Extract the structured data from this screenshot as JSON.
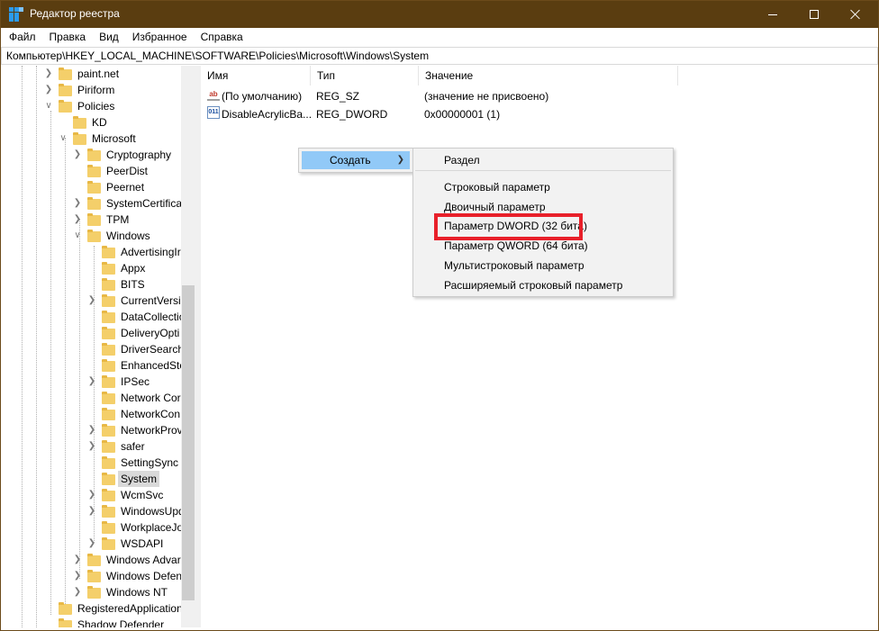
{
  "window": {
    "title": "Редактор реестра"
  },
  "menu": [
    "Файл",
    "Правка",
    "Вид",
    "Избранное",
    "Справка"
  ],
  "address": "Компьютер\\HKEY_LOCAL_MACHINE\\SOFTWARE\\Policies\\Microsoft\\Windows\\System",
  "tree": [
    {
      "label": "paint.net",
      "chev": ">"
    },
    {
      "label": "Piriform",
      "chev": ">"
    },
    {
      "label": "Policies",
      "chev": "v"
    },
    {
      "label": "KD",
      "chev": ""
    },
    {
      "label": "Microsoft",
      "chev": "v"
    },
    {
      "label": "Cryptography",
      "chev": ">"
    },
    {
      "label": "PeerDist",
      "chev": ""
    },
    {
      "label": "Peernet",
      "chev": ""
    },
    {
      "label": "SystemCertifica",
      "chev": ">"
    },
    {
      "label": "TPM",
      "chev": ">"
    },
    {
      "label": "Windows",
      "chev": "v"
    },
    {
      "label": "AdvertisingIr",
      "chev": ""
    },
    {
      "label": "Appx",
      "chev": ""
    },
    {
      "label": "BITS",
      "chev": ""
    },
    {
      "label": "CurrentVersio",
      "chev": ">"
    },
    {
      "label": "DataCollectio",
      "chev": ""
    },
    {
      "label": "DeliveryOpti",
      "chev": ""
    },
    {
      "label": "DriverSearch",
      "chev": ""
    },
    {
      "label": "EnhancedSto",
      "chev": ""
    },
    {
      "label": "IPSec",
      "chev": ">"
    },
    {
      "label": "Network Cor",
      "chev": ""
    },
    {
      "label": "NetworkCon",
      "chev": ""
    },
    {
      "label": "NetworkProv",
      "chev": ">"
    },
    {
      "label": "safer",
      "chev": ">"
    },
    {
      "label": "SettingSync",
      "chev": ""
    },
    {
      "label": "System",
      "chev": "",
      "selected": true
    },
    {
      "label": "WcmSvc",
      "chev": ">"
    },
    {
      "label": "WindowsUpd",
      "chev": ">"
    },
    {
      "label": "WorkplaceJo",
      "chev": ""
    },
    {
      "label": "WSDAPI",
      "chev": ">"
    },
    {
      "label": "Windows Advar",
      "chev": ">"
    },
    {
      "label": "Windows Defen",
      "chev": ">"
    },
    {
      "label": "Windows NT",
      "chev": ">"
    },
    {
      "label": "RegisteredApplication",
      "chev": ""
    },
    {
      "label": "Shadow Defender",
      "chev": ""
    }
  ],
  "columns": [
    "Имя",
    "Тип",
    "Значение"
  ],
  "values": [
    {
      "icon": "string-value-icon",
      "name": "(По умолчанию)",
      "type": "REG_SZ",
      "data": "(значение не присвоено)"
    },
    {
      "icon": "binary-value-icon",
      "name": "DisableAcrylicBa...",
      "type": "REG_DWORD",
      "data": "0x00000001 (1)"
    }
  ],
  "context_menu": {
    "create_label": "Создать",
    "submenu": [
      "Раздел",
      "Строковый параметр",
      "Двоичный параметр",
      "Параметр DWORD (32 бита)",
      "Параметр QWORD (64 бита)",
      "Мультистроковый параметр",
      "Расширяемый строковый параметр"
    ]
  },
  "colors": {
    "title_bar": "#5a3d10",
    "menu_highlight": "#91c9f7",
    "annotation_red": "#e8202a",
    "folder": "#f4cf6a"
  }
}
